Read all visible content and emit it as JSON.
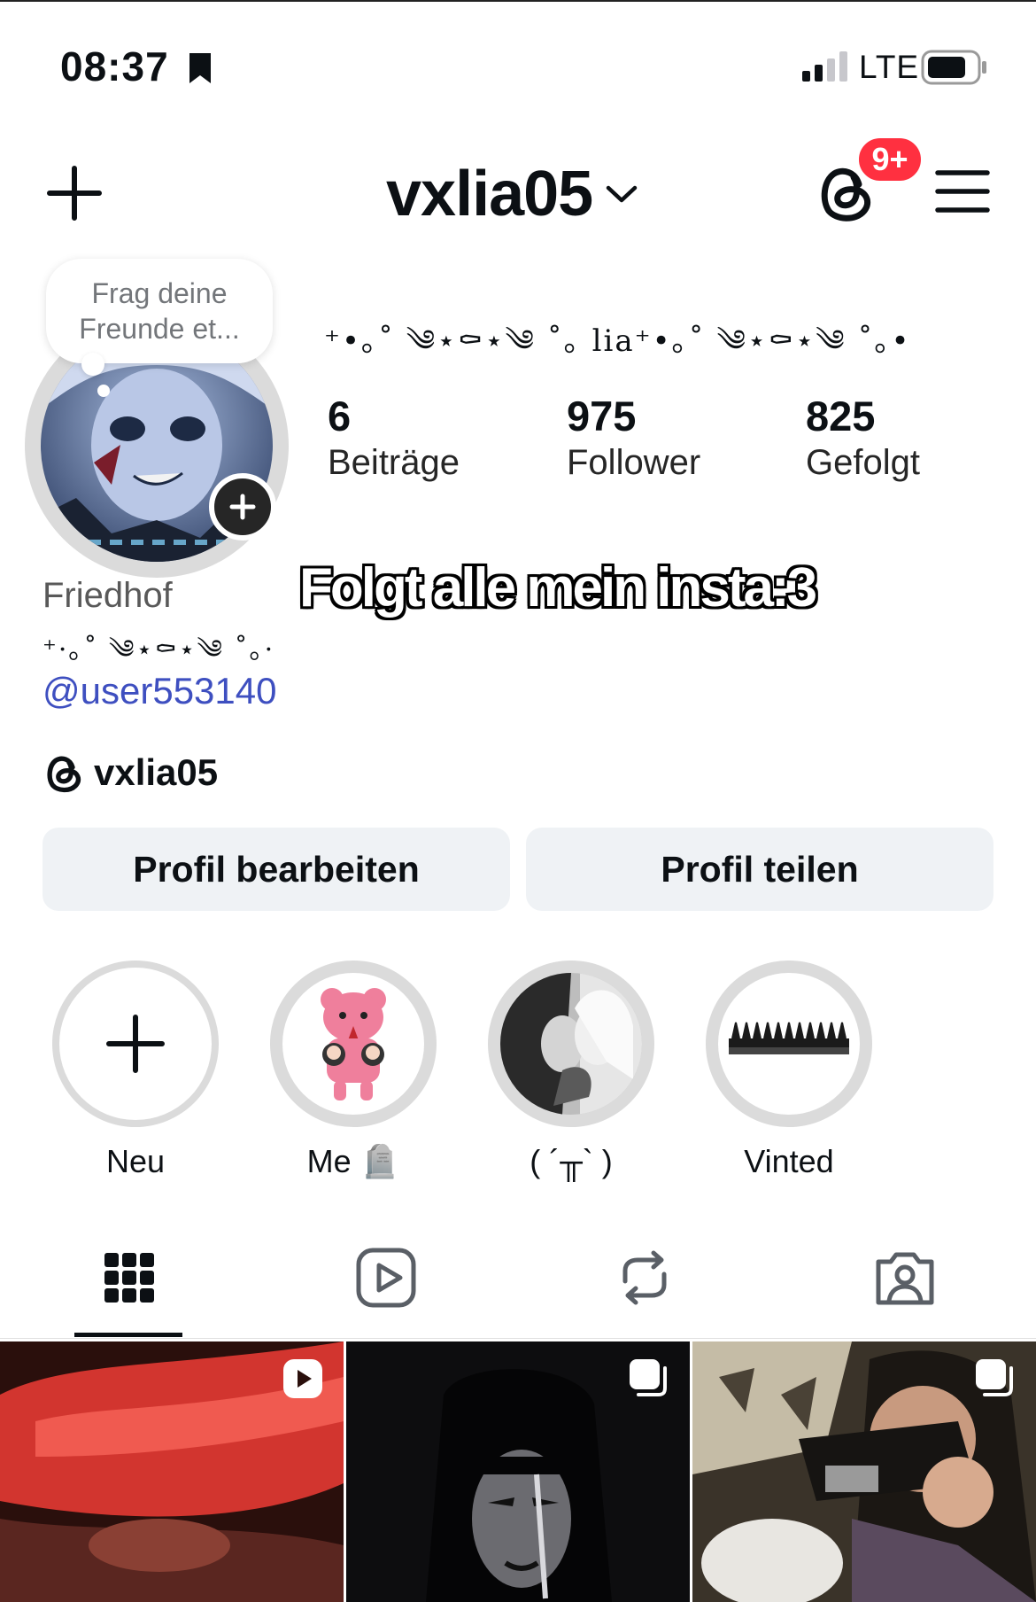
{
  "status_bar": {
    "time": "08:37",
    "network": "LTE"
  },
  "header": {
    "username": "vxlia05",
    "notification_badge": "9+"
  },
  "profile": {
    "note": [
      "Frag deine",
      "Freunde et..."
    ],
    "display_name": "⁺•｡˚ ༄⋆⚰⋆༄ ˚｡ lia⁺•｡˚ ༄⋆⚰⋆༄ ˚｡•",
    "stats": [
      {
        "value": "6",
        "label": "Beiträge"
      },
      {
        "value": "975",
        "label": "Follower"
      },
      {
        "value": "825",
        "label": "Gefolgt"
      }
    ],
    "overlay_text": "Folgt alle mein insta:3",
    "bio_name": "Friedhof",
    "bio_deco": "⁺·｡˚ ༄⋆⚰⋆༄ ˚｡·",
    "bio_link": "@user553140",
    "threads_handle": "vxlia05"
  },
  "buttons": {
    "edit": "Profil bearbeiten",
    "share": "Profil teilen"
  },
  "highlights": [
    {
      "label": "Neu"
    },
    {
      "label": "Me 🪦"
    },
    {
      "label": "( ´╥` )"
    },
    {
      "label": "Vinted"
    }
  ],
  "colors": {
    "accent_link": "#3e4fc0",
    "badge": "#ff3040",
    "button_bg": "#eff2f5"
  },
  "icons": {
    "status": [
      "bookmark-icon",
      "signal-icon",
      "battery-icon"
    ],
    "header": [
      "plus-icon",
      "threads-icon",
      "menu-icon"
    ],
    "tabs": [
      "grid-icon",
      "reels-icon",
      "reposts-icon",
      "tagged-icon"
    ],
    "posts": [
      "reel-icon",
      "carousel-icon",
      "carousel-icon"
    ]
  }
}
